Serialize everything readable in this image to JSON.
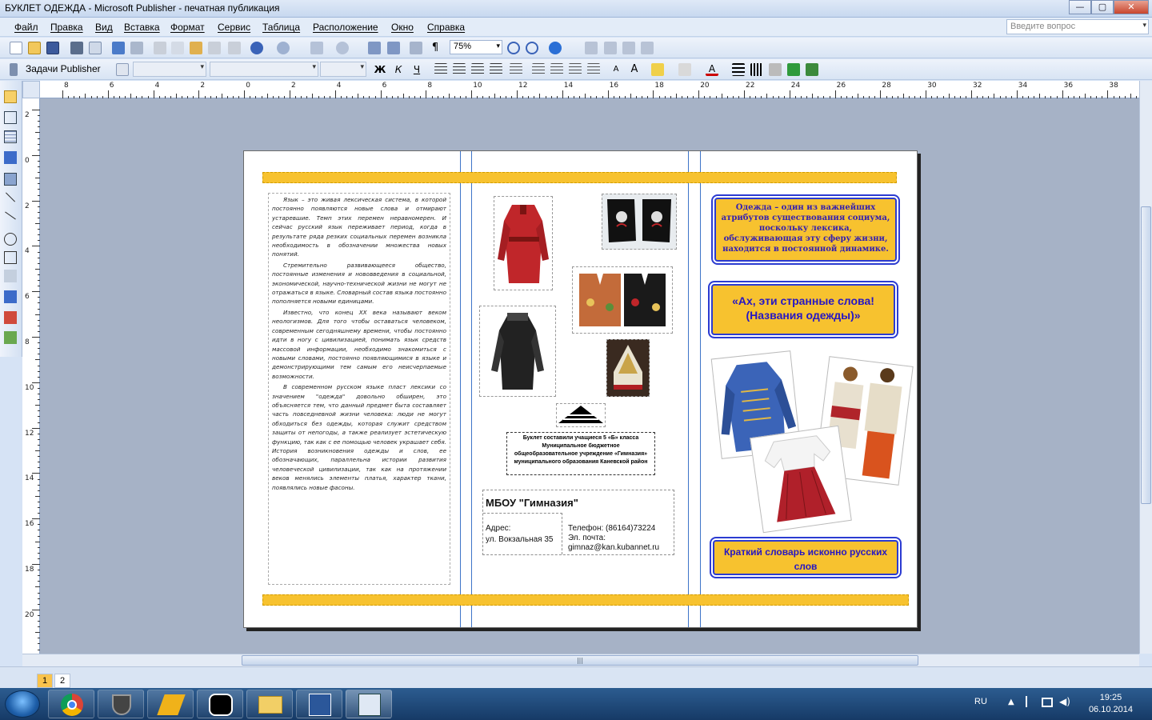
{
  "window": {
    "title": "БУКЛЕТ ОДЕЖДА - Microsoft Publisher - печатная публикация",
    "minimize": "—",
    "maximize": "▢",
    "close": "✕"
  },
  "menu": {
    "items": [
      "Файл",
      "Правка",
      "Вид",
      "Вставка",
      "Формат",
      "Сервис",
      "Таблица",
      "Расположение",
      "Окно",
      "Справка"
    ],
    "ask_placeholder": "Введите вопрос"
  },
  "toolbar": {
    "zoom": "75%",
    "tasks_label": "Задачи Publisher"
  },
  "ruler": {
    "h_labels": [
      "8",
      "6",
      "4",
      "2",
      "0",
      "2",
      "4",
      "6",
      "8",
      "10",
      "12",
      "14",
      "16",
      "18",
      "20",
      "22",
      "24",
      "26",
      "28",
      "30",
      "32",
      "34",
      "36",
      "38"
    ],
    "v_labels": [
      "2",
      "0",
      "2",
      "4",
      "6",
      "8",
      "10",
      "12",
      "14",
      "16",
      "18",
      "20"
    ]
  },
  "publication": {
    "col1_paragraphs": [
      "Язык – это живая лексическая система, в которой постоянно появляются новые слова и отмирают устаревшие. Темп этих перемен неравномерен. И сейчас русский язык переживает период, когда в результате ряда резких социальных перемен возникла необходимость в обозначении множества новых понятий.",
      "Стремительно развивающееся общество, постоянные изменения и нововведения в социальной, экономической, научно-технической жизни не могут не отражаться в языке. Словарный состав языка постоянно пополняется новыми единицами.",
      "Известно, что конец XX века называют веком неологизмов. Для того чтобы оставаться человеком, современным сегодняшнему времени, чтобы постоянно идти в ногу с цивилизацией, понимать язык средств массовой информации, необходимо знакомиться с новыми словами, постоянно появляющимися в языке и демонстрирующими тем самым его неисчерпаемые возможности.",
      "В современном русском языке пласт лексики со значением \"одежда\" довольно обширен, это объясняется тем, что данный предмет быта составляет часть повседневной жизни человека: люди не могут обходиться без одежды, которая служит средством защиты от непогоды, а также реализует эстетическую функцию, так как с ее помощью человек украшает себя. История возникновения одежды и слов, ее обозначающих, параллельна истории развития человеческой цивилизации, так как на протяжении веков менялись элементы платья, характер ткани, появлялись новые фасоны."
    ],
    "credits": "Буклет составили учащиеся 5 «Б» класса Муниципальное бюджетное общеобразовательное учреждение «Гимназия» муниципального образования Каневской район",
    "school_name": "МБОУ \"Гимназия\"",
    "address_label": "Адрес:",
    "address_value": "ул. Вокзальная 35",
    "phone": "Телефон: (86164)73224",
    "email_label": "Эл. почта:",
    "email": "gimnaz@kan.kubannet.ru",
    "callout1": "Одежда – один из важнейших атрибутов существования социума, поскольку лексика, обслуживающая эту сферу жизни, находится в постоянной динамике.",
    "callout2_line1": "«Ах, эти странные слова!",
    "callout2_line2": "(Названия одежды)»",
    "callout3": "Краткий словарь исконно русских слов"
  },
  "pages": {
    "page1": "1",
    "page2": "2"
  },
  "taskbar": {
    "lang": "RU",
    "time": "19:25",
    "date": "06.10.2014"
  },
  "colors": {
    "accent_yellow": "#f7c22f",
    "callout_blue": "#2b3bd1",
    "guide_blue": "#3e74c8",
    "canvas_gray": "#a6b2c6"
  }
}
